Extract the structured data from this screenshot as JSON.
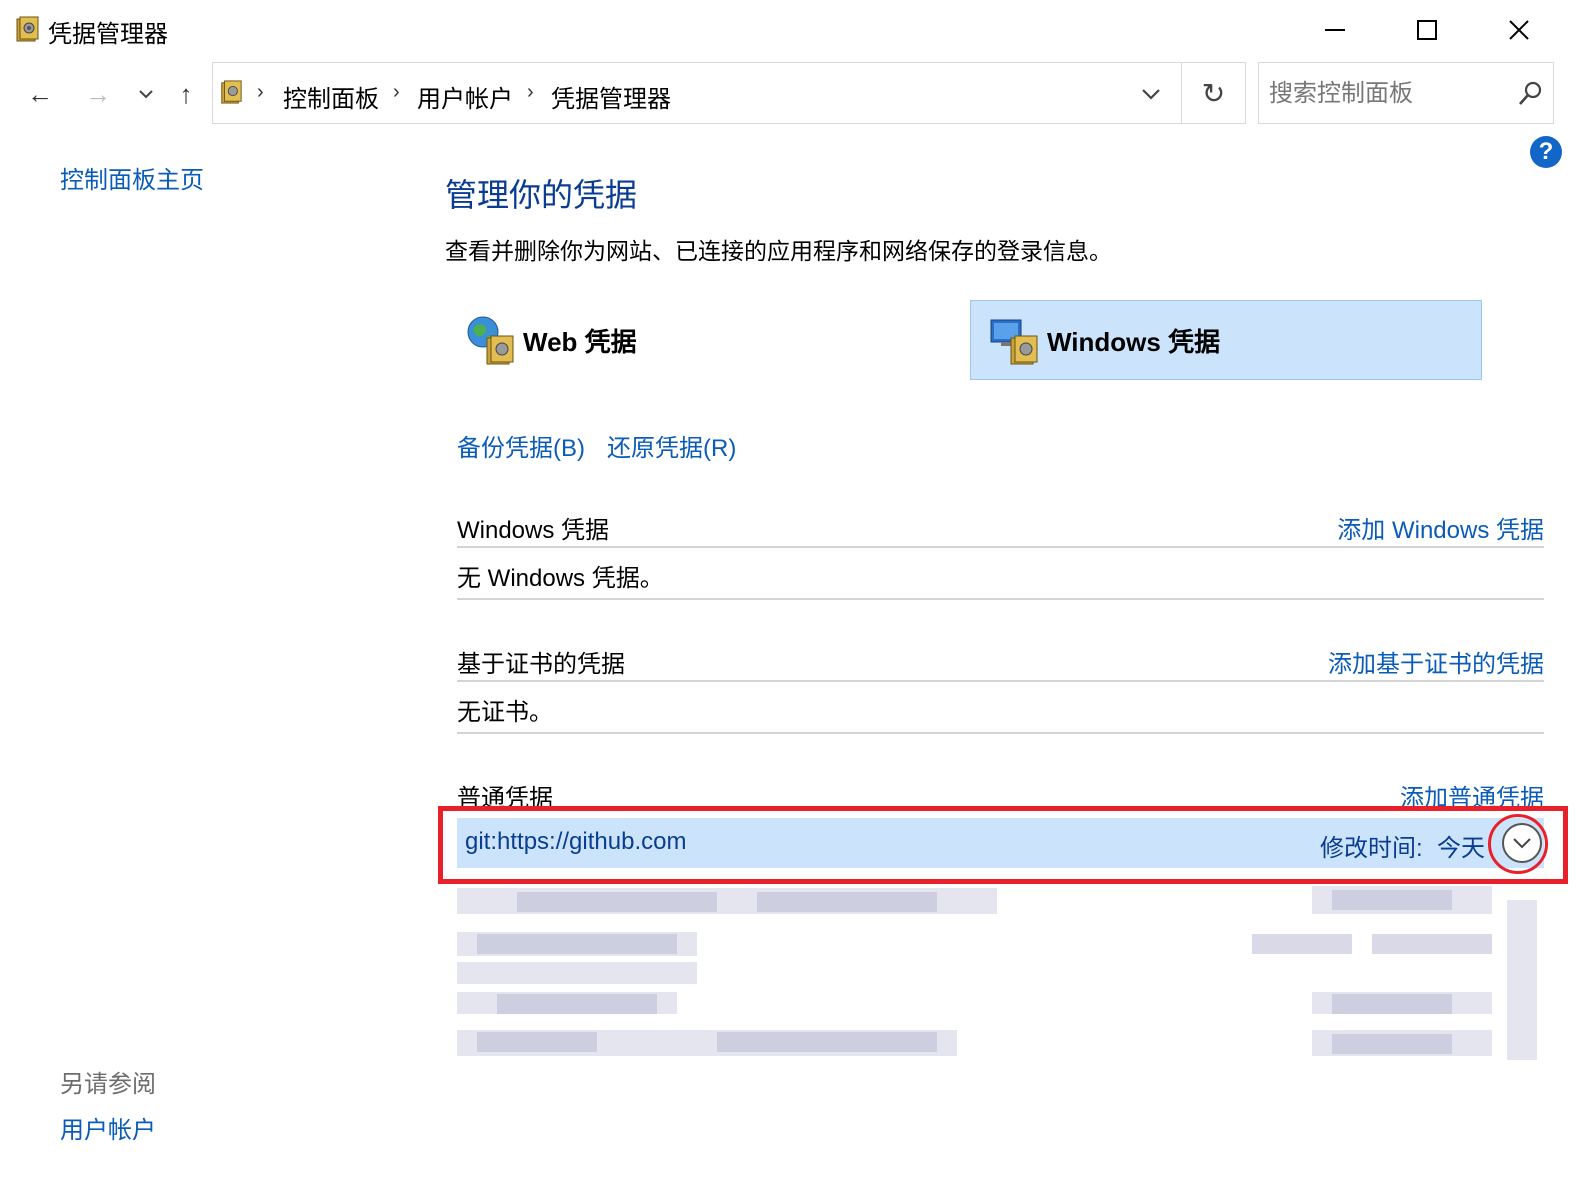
{
  "window": {
    "title": "凭据管理器",
    "controls": {
      "minimize": "minimize-icon",
      "maximize": "maximize-icon",
      "close": "close-icon"
    }
  },
  "nav": {
    "back": "←",
    "forward": "→",
    "recent": "⌄",
    "up": "↑",
    "breadcrumbs": [
      "控制面板",
      "用户帐户",
      "凭据管理器"
    ],
    "refresh": "↻",
    "search_placeholder": "搜索控制面板"
  },
  "help": "?",
  "sidebar": {
    "home": "控制面板主页",
    "see_also_label": "另请参阅",
    "see_also_items": [
      "用户帐户"
    ]
  },
  "main": {
    "title": "管理你的凭据",
    "description": "查看并删除你为网站、已连接的应用程序和网络保存的登录信息。",
    "cred_types": [
      {
        "label": "Web 凭据",
        "selected": false
      },
      {
        "label": "Windows 凭据",
        "selected": true
      }
    ],
    "backup": "备份凭据(B)",
    "restore": "还原凭据(R)",
    "sections": {
      "windows": {
        "title": "Windows 凭据",
        "add": "添加 Windows 凭据",
        "empty": "无 Windows 凭据。"
      },
      "certificate": {
        "title": "基于证书的凭据",
        "add": "添加基于证书的凭据",
        "empty": "无证书。"
      },
      "generic": {
        "title": "普通凭据",
        "add": "添加普通凭据",
        "items": [
          {
            "name": "git:https://github.com",
            "modified_label": "修改时间:",
            "modified_value": "今天"
          }
        ]
      }
    }
  },
  "colors": {
    "link": "#0a5cb8",
    "title_blue": "#0a3d91",
    "selection": "#cce4fb",
    "highlight": "#e8202a"
  }
}
